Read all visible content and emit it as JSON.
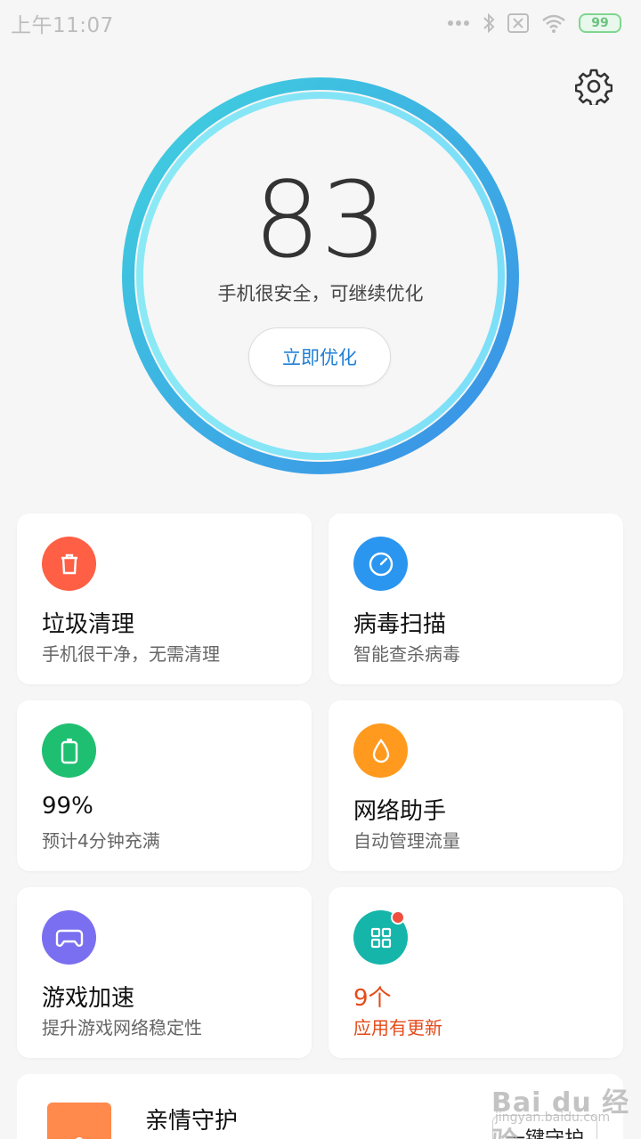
{
  "status_bar": {
    "time": "上午11:07",
    "battery": "99"
  },
  "score_panel": {
    "score": "83",
    "description": "手机很安全，可继续优化",
    "optimize_label": "立即优化"
  },
  "cards": [
    {
      "title": "垃圾清理",
      "subtitle": "手机很干净，无需清理",
      "icon": "trash-icon",
      "color": "#ff5f45"
    },
    {
      "title": "病毒扫描",
      "subtitle": "智能查杀病毒",
      "icon": "gauge-icon",
      "color": "#2a96f0"
    },
    {
      "title": "99%",
      "subtitle": "预计4分钟充满",
      "icon": "battery-icon",
      "color": "#1fbf72"
    },
    {
      "title": "网络助手",
      "subtitle": "自动管理流量",
      "icon": "drop-icon",
      "color": "#ff9a1e"
    },
    {
      "title": "游戏加速",
      "subtitle": "提升游戏网络稳定性",
      "icon": "gamepad-icon",
      "color": "#7a6ff0"
    },
    {
      "title": "9个",
      "subtitle": "应用有更新",
      "icon": "apps-grid-icon",
      "color": "#15b5aa"
    }
  ],
  "family_card": {
    "title": "亲情守护",
    "button_label": "一键守护"
  },
  "watermark": {
    "logo_text": "Bai du 经验",
    "sub_text": "jingyan.baidu.com"
  },
  "colors": {
    "accent": "#1e7fd6",
    "ring_start": "#3fd0e0",
    "ring_end": "#3a8ee8",
    "alert": "#e64a19"
  }
}
